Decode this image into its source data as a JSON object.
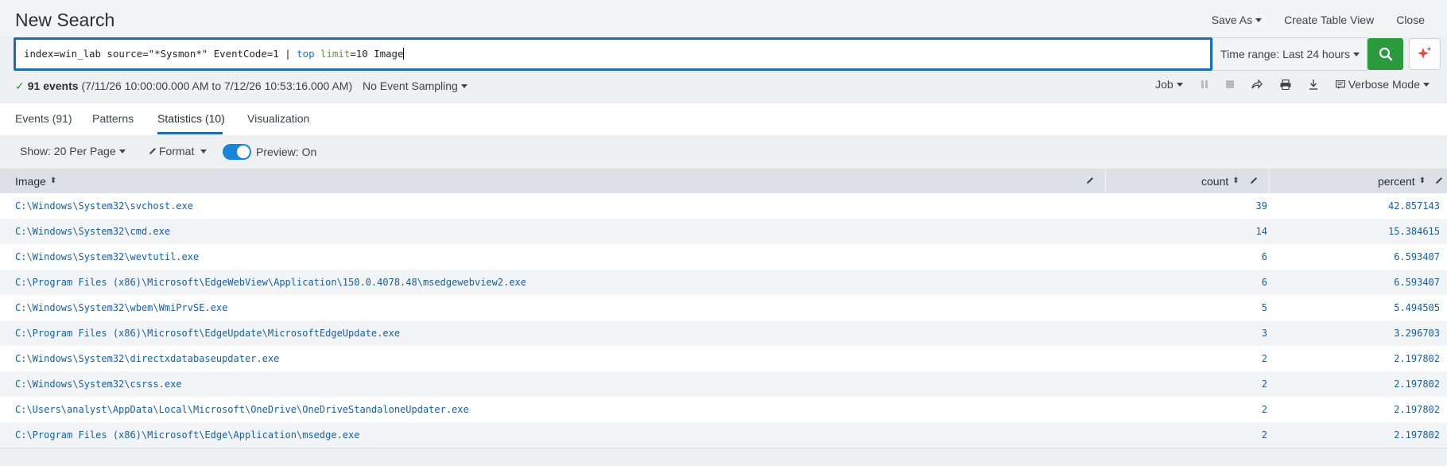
{
  "header": {
    "title": "New Search",
    "save_as": "Save As",
    "create_table_view": "Create Table View",
    "close": "Close"
  },
  "search": {
    "q_part1": "index=win_lab source=\"*Sysmon*\" EventCode=1 | ",
    "q_cmd": "top",
    "q_space": " ",
    "q_arg": "limit",
    "q_part2": "=10 Image",
    "time_range": "Time range: Last 24 hours"
  },
  "job": {
    "events_count": "91 events",
    "events_range": "(7/11/26 10:00:00.000 AM to 7/12/26 10:53:16.000 AM)",
    "sampling": "No Event Sampling",
    "job_label": "Job",
    "mode": "Verbose Mode"
  },
  "tabs": [
    {
      "label": "Events (91)"
    },
    {
      "label": "Patterns"
    },
    {
      "label": "Statistics (10)"
    },
    {
      "label": "Visualization"
    }
  ],
  "controls": {
    "per_page": "Show: 20 Per Page",
    "format": "Format",
    "preview": "Preview: On"
  },
  "table": {
    "columns": [
      "Image",
      "count",
      "percent"
    ],
    "rows": [
      {
        "image": "C:\\Windows\\System32\\svchost.exe",
        "count": "39",
        "percent": "42.857143"
      },
      {
        "image": "C:\\Windows\\System32\\cmd.exe",
        "count": "14",
        "percent": "15.384615"
      },
      {
        "image": "C:\\Windows\\System32\\wevtutil.exe",
        "count": "6",
        "percent": "6.593407"
      },
      {
        "image": "C:\\Program Files (x86)\\Microsoft\\EdgeWebView\\Application\\150.0.4078.48\\msedgewebview2.exe",
        "count": "6",
        "percent": "6.593407"
      },
      {
        "image": "C:\\Windows\\System32\\wbem\\WmiPrvSE.exe",
        "count": "5",
        "percent": "5.494505"
      },
      {
        "image": "C:\\Program Files (x86)\\Microsoft\\EdgeUpdate\\MicrosoftEdgeUpdate.exe",
        "count": "3",
        "percent": "3.296703"
      },
      {
        "image": "C:\\Windows\\System32\\directxdatabaseupdater.exe",
        "count": "2",
        "percent": "2.197802"
      },
      {
        "image": "C:\\Windows\\System32\\csrss.exe",
        "count": "2",
        "percent": "2.197802"
      },
      {
        "image": "C:\\Users\\analyst\\AppData\\Local\\Microsoft\\OneDrive\\OneDriveStandaloneUpdater.exe",
        "count": "2",
        "percent": "2.197802"
      },
      {
        "image": "C:\\Program Files (x86)\\Microsoft\\Edge\\Application\\msedge.exe",
        "count": "2",
        "percent": "2.197802"
      }
    ]
  },
  "colors": {
    "accent": "#1a6fa8",
    "search_button": "#2b9a3d",
    "link": "#1a5f9a"
  }
}
